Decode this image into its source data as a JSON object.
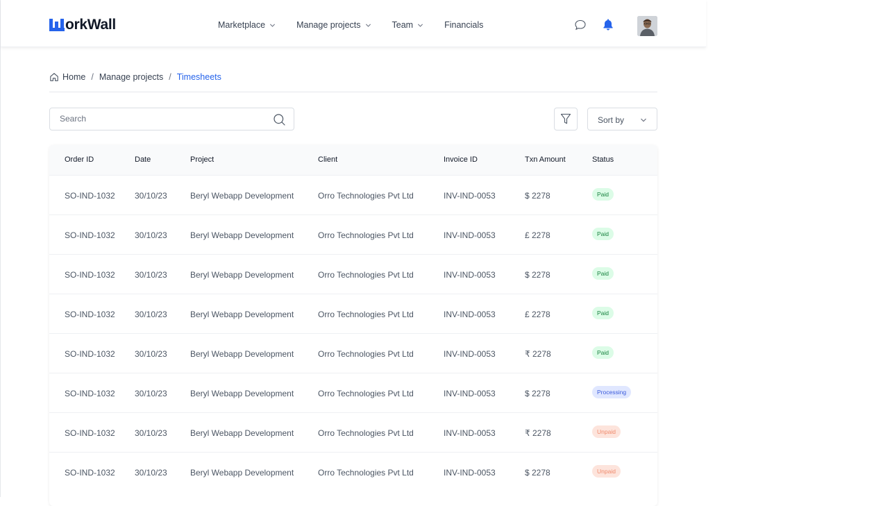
{
  "app": {
    "logo_text": "orkWall",
    "nav": [
      {
        "label": "Marketplace",
        "has_dropdown": true
      },
      {
        "label": "Manage projects",
        "has_dropdown": true
      },
      {
        "label": "Team",
        "has_dropdown": true
      },
      {
        "label": "Financials",
        "has_dropdown": false
      }
    ],
    "icons": [
      "chat-icon",
      "bell-icon"
    ],
    "colors": {
      "accent": "#2563eb",
      "bell": "#2563eb"
    }
  },
  "breadcrumb": {
    "items": [
      "Home",
      "Manage projects",
      "Timesheets"
    ],
    "separator": "/"
  },
  "toolbar": {
    "search_placeholder": "Search",
    "sort_label": "Sort by"
  },
  "table": {
    "columns": [
      "Order ID",
      "Date",
      "Project",
      "Client",
      "Invoice ID",
      "Txn Amount",
      "Status"
    ],
    "rows": [
      {
        "order_id": "SO-IND-1032",
        "date": "30/10/23",
        "project": "Beryl Webapp Development",
        "client": "Orro Technologies Pvt Ltd",
        "invoice_id": "INV-IND-0053",
        "amount": "$ 2278",
        "status": "Paid"
      },
      {
        "order_id": "SO-IND-1032",
        "date": "30/10/23",
        "project": "Beryl Webapp Development",
        "client": "Orro Technologies Pvt Ltd",
        "invoice_id": "INV-IND-0053",
        "amount": "£ 2278",
        "status": "Paid"
      },
      {
        "order_id": "SO-IND-1032",
        "date": "30/10/23",
        "project": "Beryl Webapp Development",
        "client": "Orro Technologies Pvt Ltd",
        "invoice_id": "INV-IND-0053",
        "amount": "$ 2278",
        "status": "Paid"
      },
      {
        "order_id": "SO-IND-1032",
        "date": "30/10/23",
        "project": "Beryl Webapp Development",
        "client": "Orro Technologies Pvt Ltd",
        "invoice_id": "INV-IND-0053",
        "amount": "£ 2278",
        "status": "Paid"
      },
      {
        "order_id": "SO-IND-1032",
        "date": "30/10/23",
        "project": "Beryl Webapp Development",
        "client": "Orro Technologies Pvt Ltd",
        "invoice_id": "INV-IND-0053",
        "amount": "₹ 2278",
        "status": "Paid"
      },
      {
        "order_id": "SO-IND-1032",
        "date": "30/10/23",
        "project": "Beryl Webapp Development",
        "client": "Orro Technologies Pvt Ltd",
        "invoice_id": "INV-IND-0053",
        "amount": "$ 2278",
        "status": "Processing"
      },
      {
        "order_id": "SO-IND-1032",
        "date": "30/10/23",
        "project": "Beryl Webapp Development",
        "client": "Orro Technologies Pvt Ltd",
        "invoice_id": "INV-IND-0053",
        "amount": "₹ 2278",
        "status": "Unpaid"
      },
      {
        "order_id": "SO-IND-1032",
        "date": "30/10/23",
        "project": "Beryl Webapp Development",
        "client": "Orro Technologies Pvt Ltd",
        "invoice_id": "INV-IND-0053",
        "amount": "$ 2278",
        "status": "Unpaid"
      }
    ]
  },
  "status_colors": {
    "Paid": {
      "bg": "#dcfce7",
      "fg": "#15803d"
    },
    "Processing": {
      "bg": "#e0e7ff",
      "fg": "#3b5bdb"
    },
    "Unpaid": {
      "bg": "#fde4dc",
      "fg": "#f08a6c"
    }
  }
}
